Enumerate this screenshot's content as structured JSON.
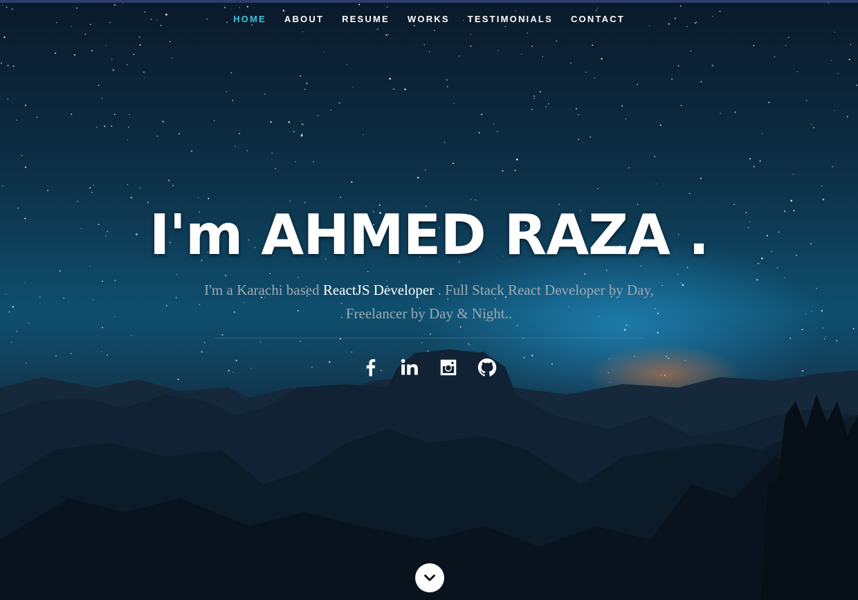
{
  "nav": {
    "items": [
      {
        "label": "HOME",
        "active": true
      },
      {
        "label": "ABOUT",
        "active": false
      },
      {
        "label": "RESUME",
        "active": false
      },
      {
        "label": "WORKS",
        "active": false
      },
      {
        "label": "TESTIMONIALS",
        "active": false
      },
      {
        "label": "CONTACT",
        "active": false
      }
    ],
    "active_color": "#3fc3d8"
  },
  "banner": {
    "headline": "I'm AHMED RAZA .",
    "tagline_prefix": "I'm a Karachi based",
    "tagline_highlight": "ReactJS Developer",
    "tagline_suffix": ". Full Stack React Developer by Day, Freelancer by Day & Night.."
  },
  "social": {
    "icons": [
      "facebook-icon",
      "linkedin-icon",
      "instagram-icon",
      "github-icon"
    ]
  },
  "scroll": {
    "icon": "chevron-down-icon"
  }
}
